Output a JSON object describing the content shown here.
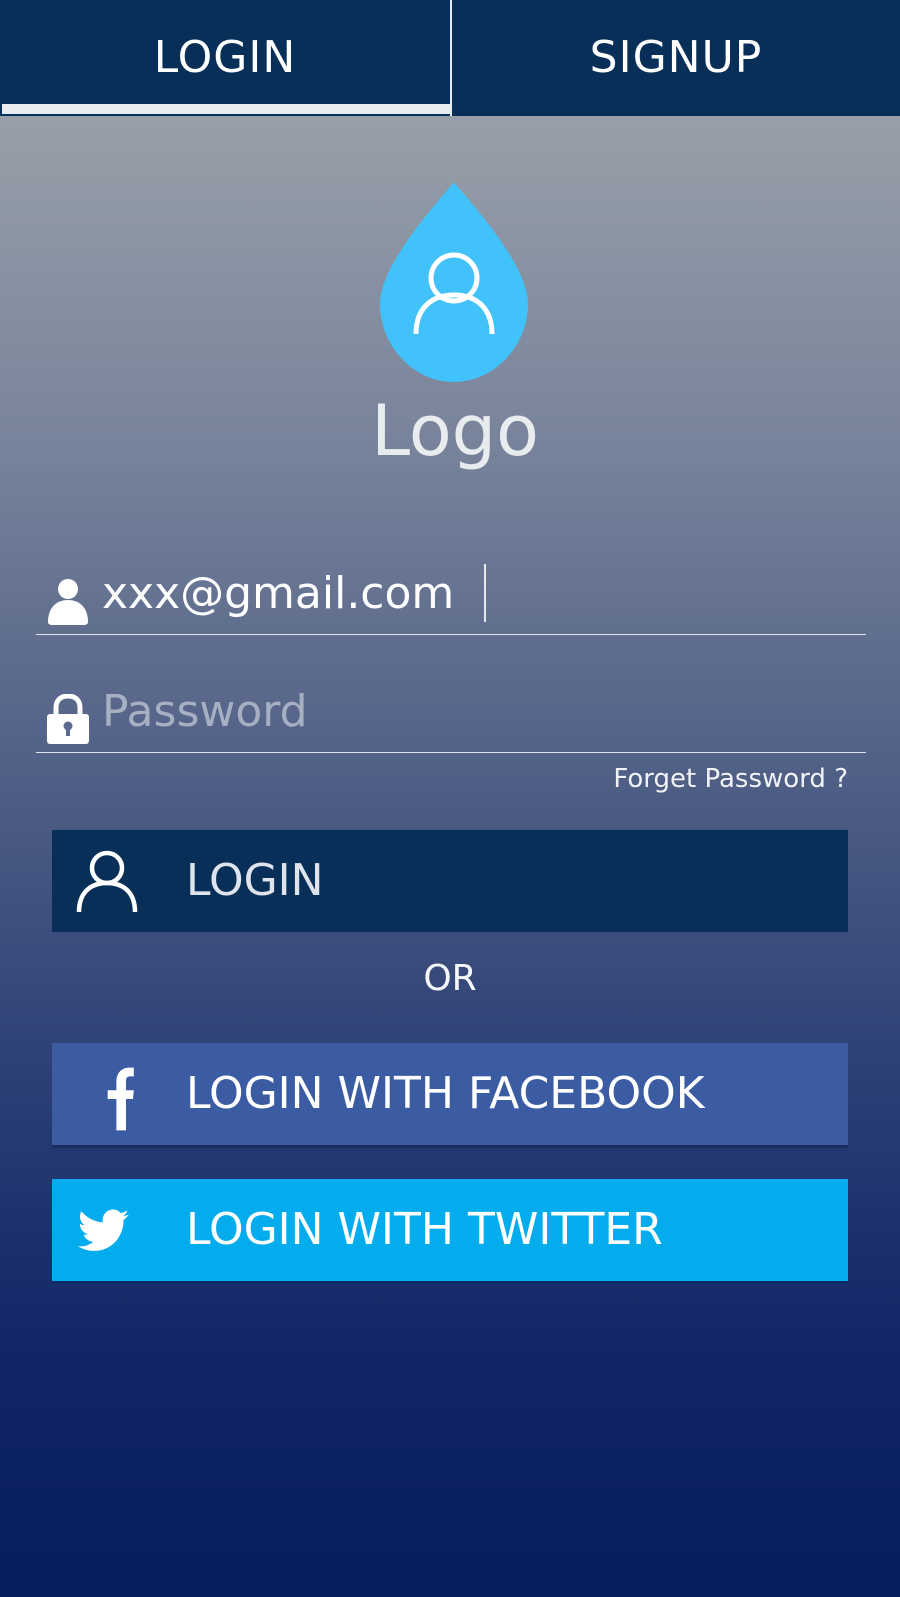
{
  "tabs": {
    "login_label": "LOGIN",
    "signup_label": "SIGNUP",
    "active": "login"
  },
  "logo": {
    "text": "Logo",
    "icon": "user-drop-icon",
    "color": "#41c2fb"
  },
  "email_field": {
    "icon": "user-icon",
    "value": "xxx@gmail.com",
    "placeholder": ""
  },
  "password_field": {
    "icon": "lock-icon",
    "value": "",
    "placeholder": "Password"
  },
  "forgot_link": "Forget Password ?",
  "login_button": {
    "label": "LOGIN",
    "icon": "user-outline-icon",
    "color": "#072f57"
  },
  "separator": "OR",
  "facebook_button": {
    "label": "LOGIN WITH FACEBOOK",
    "icon": "facebook-icon",
    "color": "#3b5ba3"
  },
  "twitter_button": {
    "label": "LOGIN WITH TWITTER",
    "icon": "twitter-icon",
    "color": "#03acec"
  }
}
